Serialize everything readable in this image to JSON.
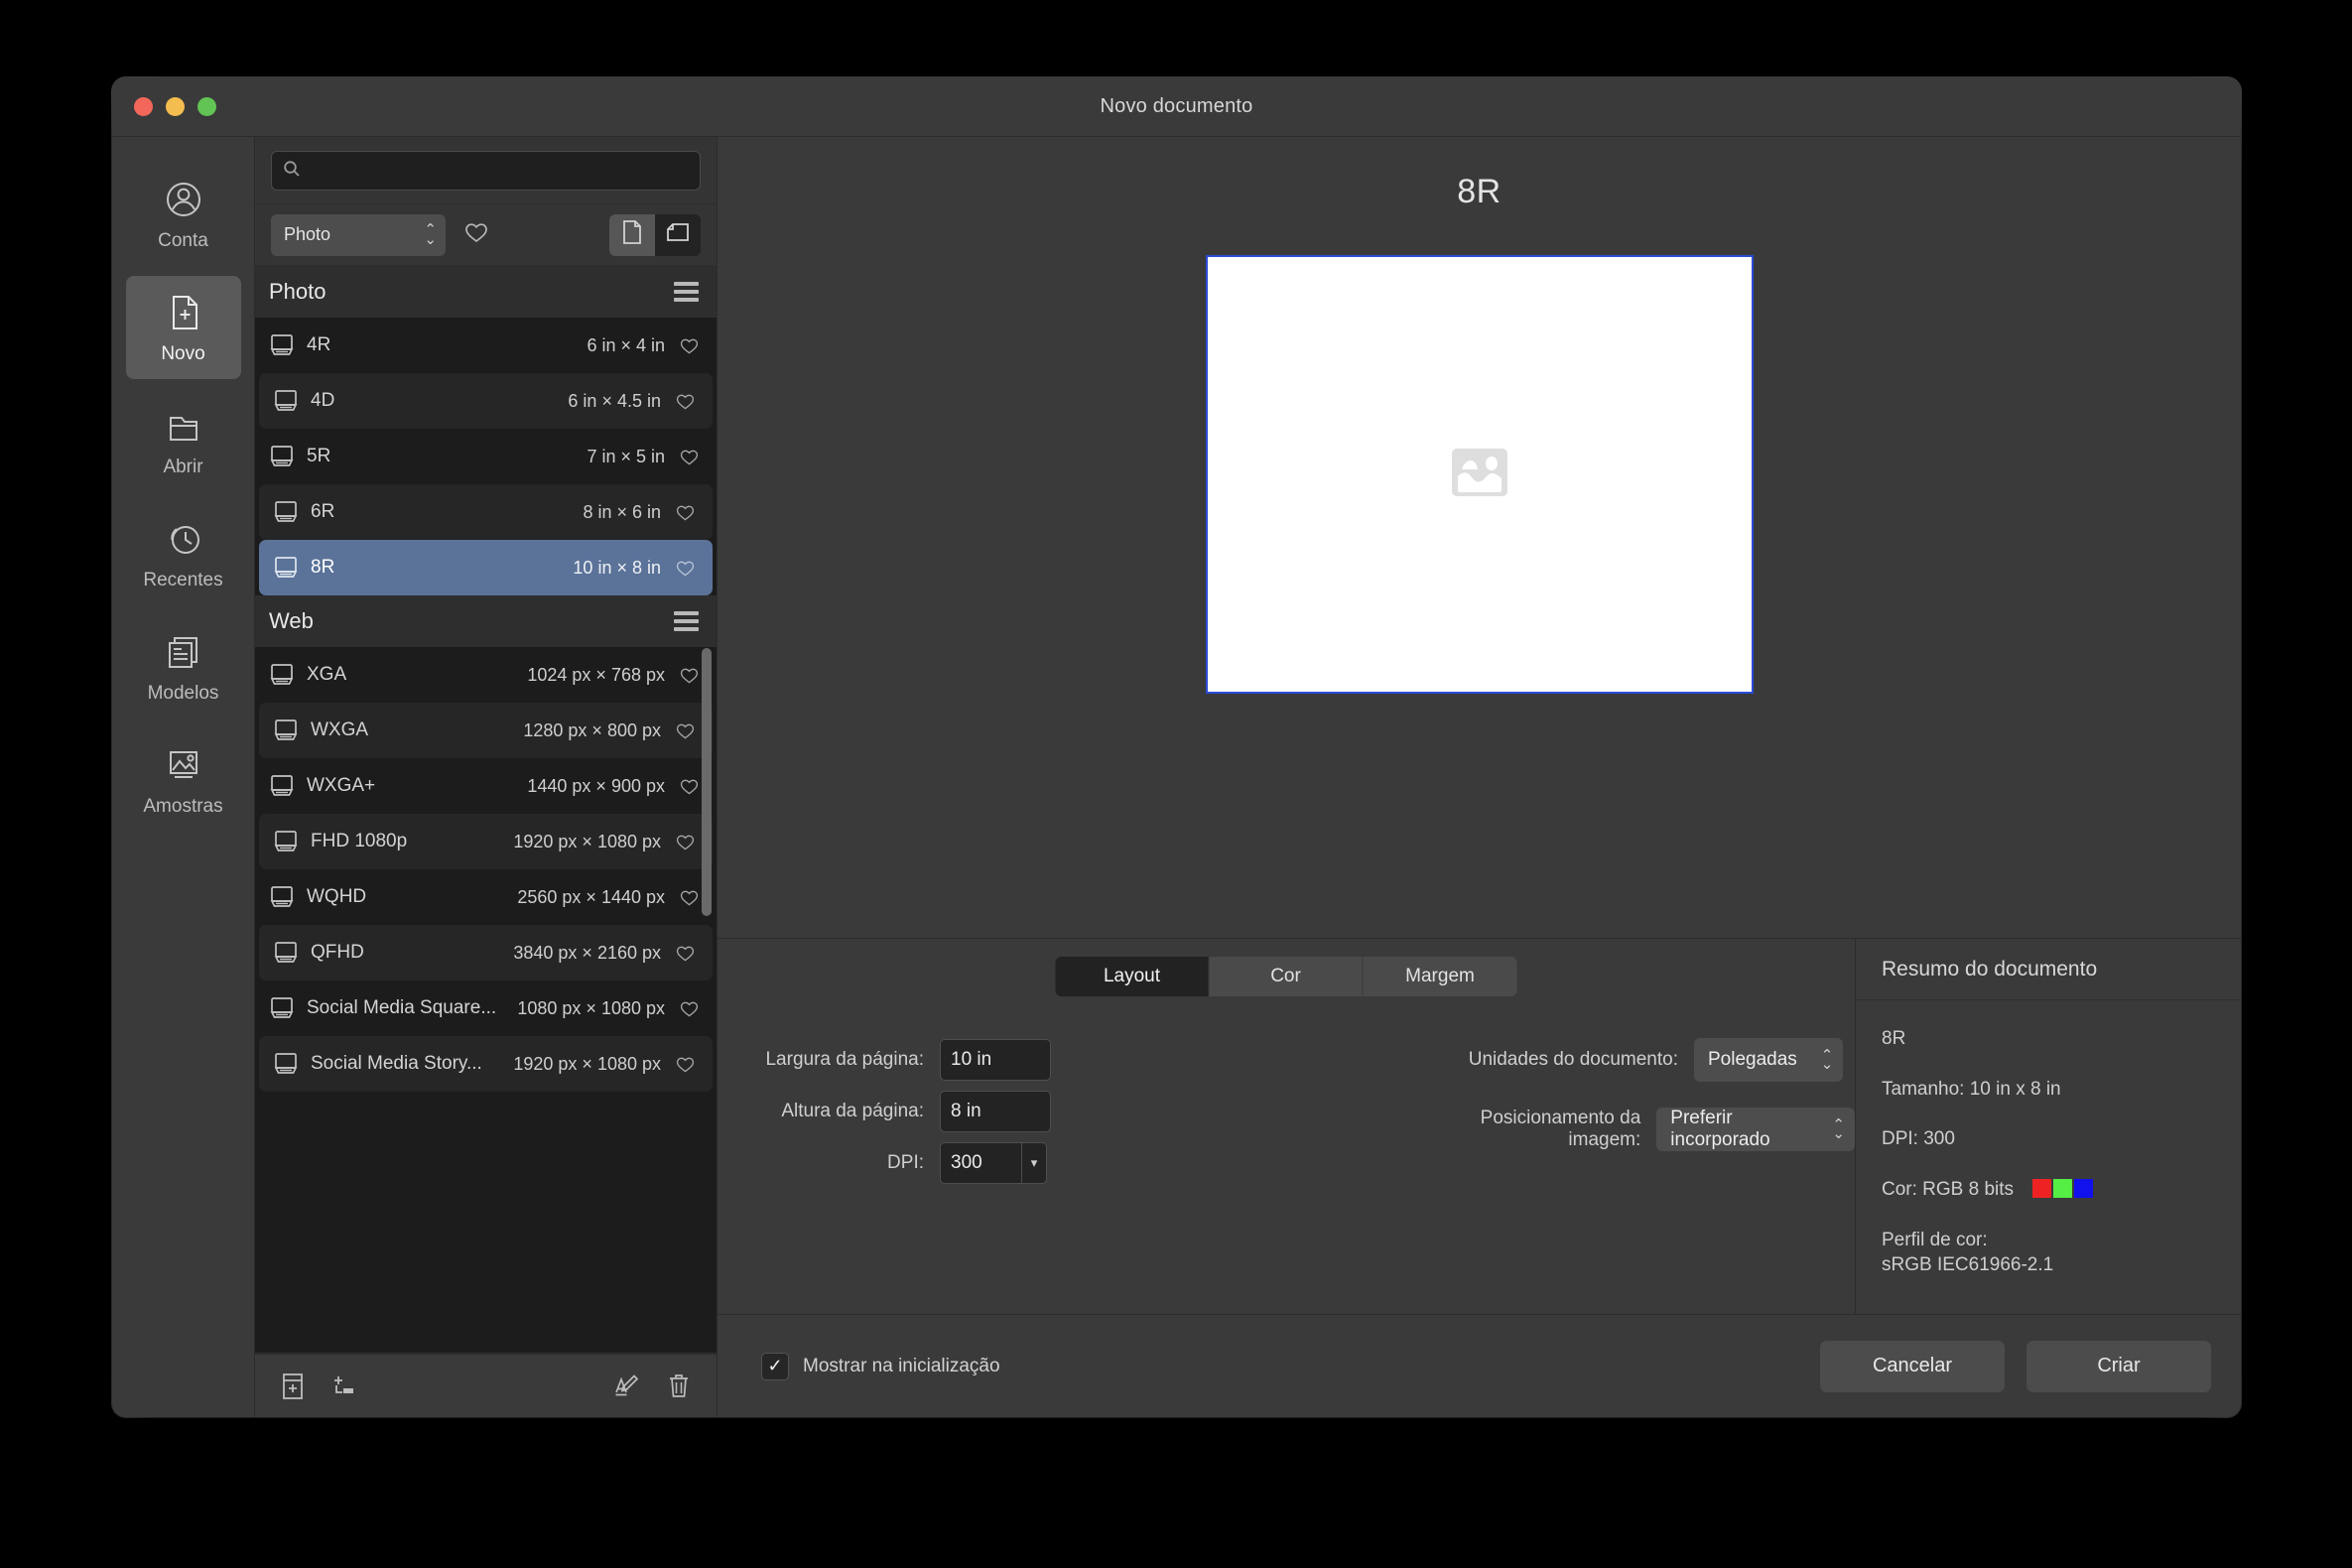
{
  "window": {
    "title": "Novo documento"
  },
  "rail": {
    "items": [
      {
        "label": "Conta",
        "icon": "account-icon",
        "active": false
      },
      {
        "label": "Novo",
        "icon": "new-document-icon",
        "active": true
      },
      {
        "label": "Abrir",
        "icon": "folder-open-icon",
        "active": false
      },
      {
        "label": "Recentes",
        "icon": "clock-history-icon",
        "active": false
      },
      {
        "label": "Modelos",
        "icon": "templates-icon",
        "active": false
      },
      {
        "label": "Amostras",
        "icon": "samples-image-icon",
        "active": false
      }
    ]
  },
  "presets": {
    "search": {
      "placeholder": "",
      "value": "",
      "icon": "search-icon"
    },
    "category": {
      "value": "Photo",
      "icon": "chevron-updown-icon"
    },
    "favorite_icon": "heart-icon",
    "view_modes": [
      {
        "icon": "page-view-icon",
        "active": true
      },
      {
        "icon": "landscape-view-icon",
        "active": false
      }
    ],
    "groups": [
      {
        "title": "Photo",
        "menu_icon": "hamburger-icon",
        "items": [
          {
            "name": "4R",
            "dimensions": "6 in × 4 in",
            "selected": false
          },
          {
            "name": "4D",
            "dimensions": "6 in × 4.5 in",
            "selected": false
          },
          {
            "name": "5R",
            "dimensions": "7 in × 5 in",
            "selected": false
          },
          {
            "name": "6R",
            "dimensions": "8 in × 6 in",
            "selected": false
          },
          {
            "name": "8R",
            "dimensions": "10 in × 8 in",
            "selected": true
          }
        ]
      },
      {
        "title": "Web",
        "menu_icon": "hamburger-icon",
        "items": [
          {
            "name": "XGA",
            "dimensions": "1024 px × 768 px",
            "selected": false
          },
          {
            "name": "WXGA",
            "dimensions": "1280 px × 800 px",
            "selected": false
          },
          {
            "name": "WXGA+",
            "dimensions": "1440 px × 900 px",
            "selected": false
          },
          {
            "name": "FHD 1080p",
            "dimensions": "1920 px × 1080 px",
            "selected": false
          },
          {
            "name": "WQHD",
            "dimensions": "2560 px × 1440 px",
            "selected": false
          },
          {
            "name": "QFHD",
            "dimensions": "3840 px × 2160 px",
            "selected": false
          },
          {
            "name": "Social Media Square...",
            "dimensions": "1080 px × 1080 px",
            "selected": false
          },
          {
            "name": "Social Media Story...",
            "dimensions": "1920 px × 1080 px",
            "selected": false
          }
        ]
      }
    ],
    "toolbar": [
      {
        "icon": "add-preset-icon"
      },
      {
        "icon": "add-category-icon"
      },
      {
        "icon": "rename-icon"
      },
      {
        "icon": "trash-icon"
      }
    ]
  },
  "preview": {
    "title": "8R",
    "placeholder_icon": "image-placeholder-icon",
    "border_color": "#2b4bd6"
  },
  "form": {
    "tabs": [
      {
        "label": "Layout",
        "active": true
      },
      {
        "label": "Cor",
        "active": false
      },
      {
        "label": "Margem",
        "active": false
      }
    ],
    "fields": [
      {
        "label": "Largura da página:",
        "value": "10 in"
      },
      {
        "label": "Altura da página:",
        "value": "8 in"
      },
      {
        "label": "DPI:",
        "value": "300"
      }
    ],
    "units": {
      "label": "Unidades do documento:",
      "value": "Polegadas"
    },
    "placement": {
      "label": "Posicionamento da imagem:",
      "value": "Preferir incorporado"
    }
  },
  "summary": {
    "heading": "Resumo do documento",
    "name": "8R",
    "size": "Tamanho: 10 in x 8 in",
    "dpi": "DPI:  300",
    "color": "Cor: RGB 8 bits",
    "profile_label": "Perfil de cor:",
    "profile_value": "sRGB IEC61966-2.1",
    "swatches": [
      "#ee2222",
      "#55ee44",
      "#1111ee"
    ]
  },
  "footer": {
    "checkbox": {
      "label": "Mostrar na inicialização",
      "checked": true,
      "mark": "✓"
    },
    "cancel_label": "Cancelar",
    "create_label": "Criar"
  }
}
